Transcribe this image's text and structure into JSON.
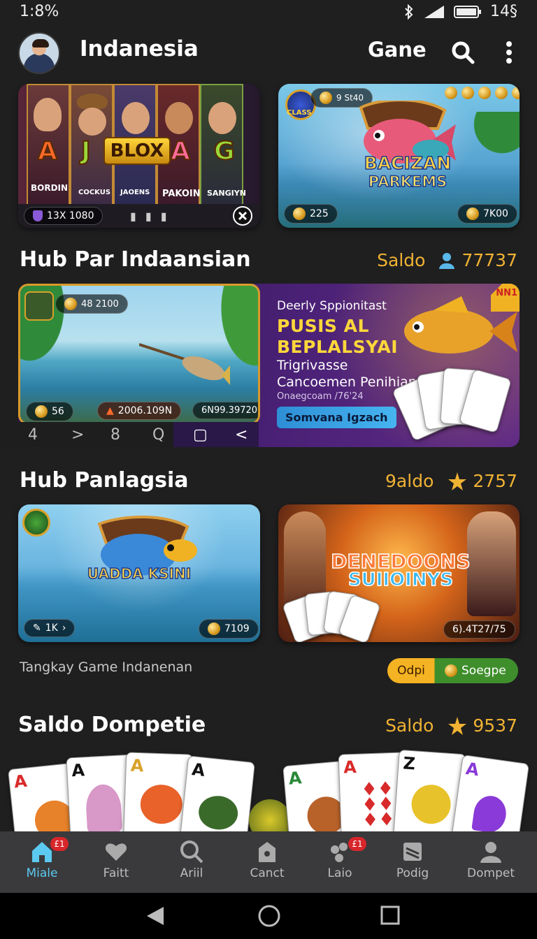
{
  "status": {
    "time": "1:8%",
    "battery": "14§"
  },
  "header": {
    "title": "Indanesia",
    "game_label": "Gane"
  },
  "banner1": {
    "reel_letters": [
      "A",
      "J",
      "A",
      "G"
    ],
    "title": "BLOX",
    "reel_labels": [
      "BORDIN",
      "COCKUS",
      "JAOENS",
      "PAKOIN",
      "SANGIYN"
    ],
    "info": "13X 1080",
    "dots": "▮ ▮ ▮"
  },
  "banner2": {
    "top_pill": "9 St40",
    "logo": "CLASS",
    "title_line1": "BACIZAN",
    "title_line2": "PARKEMS",
    "left_pill": "225",
    "right_pill": "7K00"
  },
  "section1": {
    "title": "Hub Par Indaansian",
    "saldo_label": "Saldo",
    "saldo_value": "77737"
  },
  "big_banner": {
    "top_pill": "48 2100",
    "left_pill": "56",
    "mid_pill": "2006.109N",
    "right_pill": "6N99.39720",
    "small_heading": "Deerly Sppionitast",
    "title_line1": "PUSIS AL",
    "title_line2": "BEPLALSYAI",
    "line1": "Trigrivasse",
    "line2": "Cancoemen Penihian",
    "line3": "Onaegcoam /76'24",
    "button": "Somvana Igzach",
    "corner_tag": "NN1",
    "nav_items": [
      "4",
      ">",
      "8",
      "Q",
      "▢",
      "<"
    ]
  },
  "section2": {
    "title": "Hub Panlagsia",
    "saldo_label": "9aldo",
    "saldo_value": "2757"
  },
  "tile3": {
    "title": "UADDA KSINI",
    "left_pill": "1K",
    "right_pill": "7109"
  },
  "tile4": {
    "title_line1": "DENEDOONS",
    "title_line2": "SUIIOINYS",
    "right_pill": "6).4T27/75"
  },
  "promo_row": {
    "text": "Tangkay Game Indanenan",
    "toggle_left": "Odpi",
    "toggle_right": "Soegpe"
  },
  "section3": {
    "title": "Saldo Dompetie",
    "saldo_label": "Saldo",
    "saldo_value": "9537"
  },
  "playing_cards": [
    "A",
    "A",
    "A",
    "A",
    "A",
    "A",
    "Z",
    "A"
  ],
  "bottom_nav": {
    "items": [
      {
        "label": "Miale",
        "icon": "home-icon",
        "badge": "£1",
        "active": true
      },
      {
        "label": "Faitt",
        "icon": "heart-icon"
      },
      {
        "label": "Ariil",
        "icon": "search-icon"
      },
      {
        "label": "Canct",
        "icon": "shield-icon"
      },
      {
        "label": "Laio",
        "icon": "group-icon",
        "badge": "£1"
      },
      {
        "label": "Podig",
        "icon": "document-icon"
      },
      {
        "label": "Dompet",
        "icon": "profile-icon"
      }
    ]
  },
  "colors": {
    "accent_gold": "#f0b233",
    "active_nav": "#5ccaf0",
    "background": "#1f1f20",
    "badge_red": "#d8262b"
  }
}
